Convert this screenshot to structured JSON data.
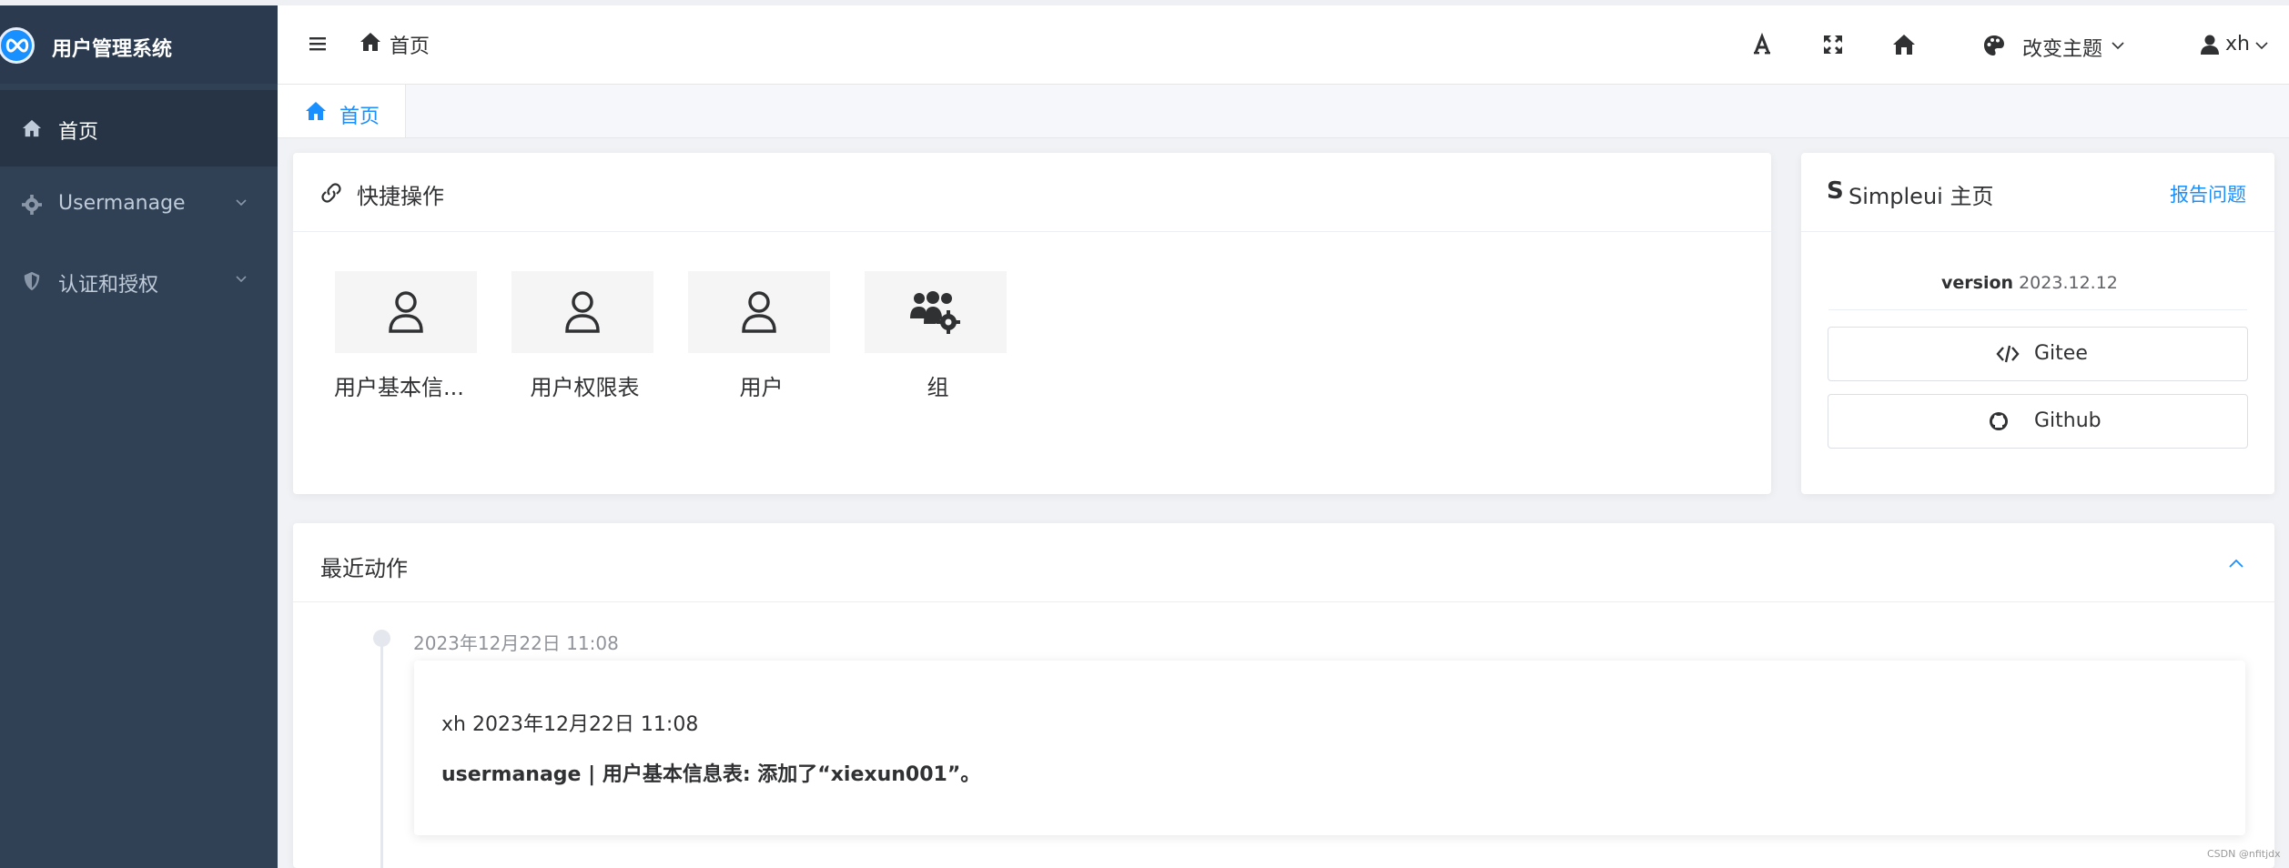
{
  "app": {
    "title": "用户管理系统"
  },
  "sidebar": {
    "items": [
      {
        "label": "首页",
        "icon": "home-icon"
      },
      {
        "label": "Usermanage",
        "icon": "gear-icon"
      },
      {
        "label": "认证和授权",
        "icon": "shield-icon"
      }
    ]
  },
  "header": {
    "breadcrumb": "首页",
    "theme_label": "改变主题",
    "user_name": "xh"
  },
  "tabs": [
    {
      "label": "首页"
    }
  ],
  "quick_actions": {
    "title": "快捷操作",
    "items": [
      {
        "label": "用户基本信...",
        "icon": "user-icon"
      },
      {
        "label": "用户权限表",
        "icon": "user-icon"
      },
      {
        "label": "用户",
        "icon": "user-icon"
      },
      {
        "label": "组",
        "icon": "users-cog-icon"
      }
    ]
  },
  "simpleui": {
    "title": "Simpleui 主页",
    "report_link": "报告问题",
    "version_label": "version",
    "version_value": "2023.12.12",
    "links": [
      {
        "label": "Gitee",
        "icon": "code-icon"
      },
      {
        "label": "Github",
        "icon": "github-icon"
      }
    ]
  },
  "recent": {
    "title": "最近动作",
    "entries": [
      {
        "time": "2023年12月22日 11:08",
        "line1": "xh 2023年12月22日 11:08",
        "line2": "usermanage | 用户基本信息表: 添加了“xiexun001”。"
      }
    ]
  },
  "watermark": "CSDN @nfitjdx",
  "colors": {
    "sidebar": "#304156",
    "accent": "#1890ff"
  }
}
